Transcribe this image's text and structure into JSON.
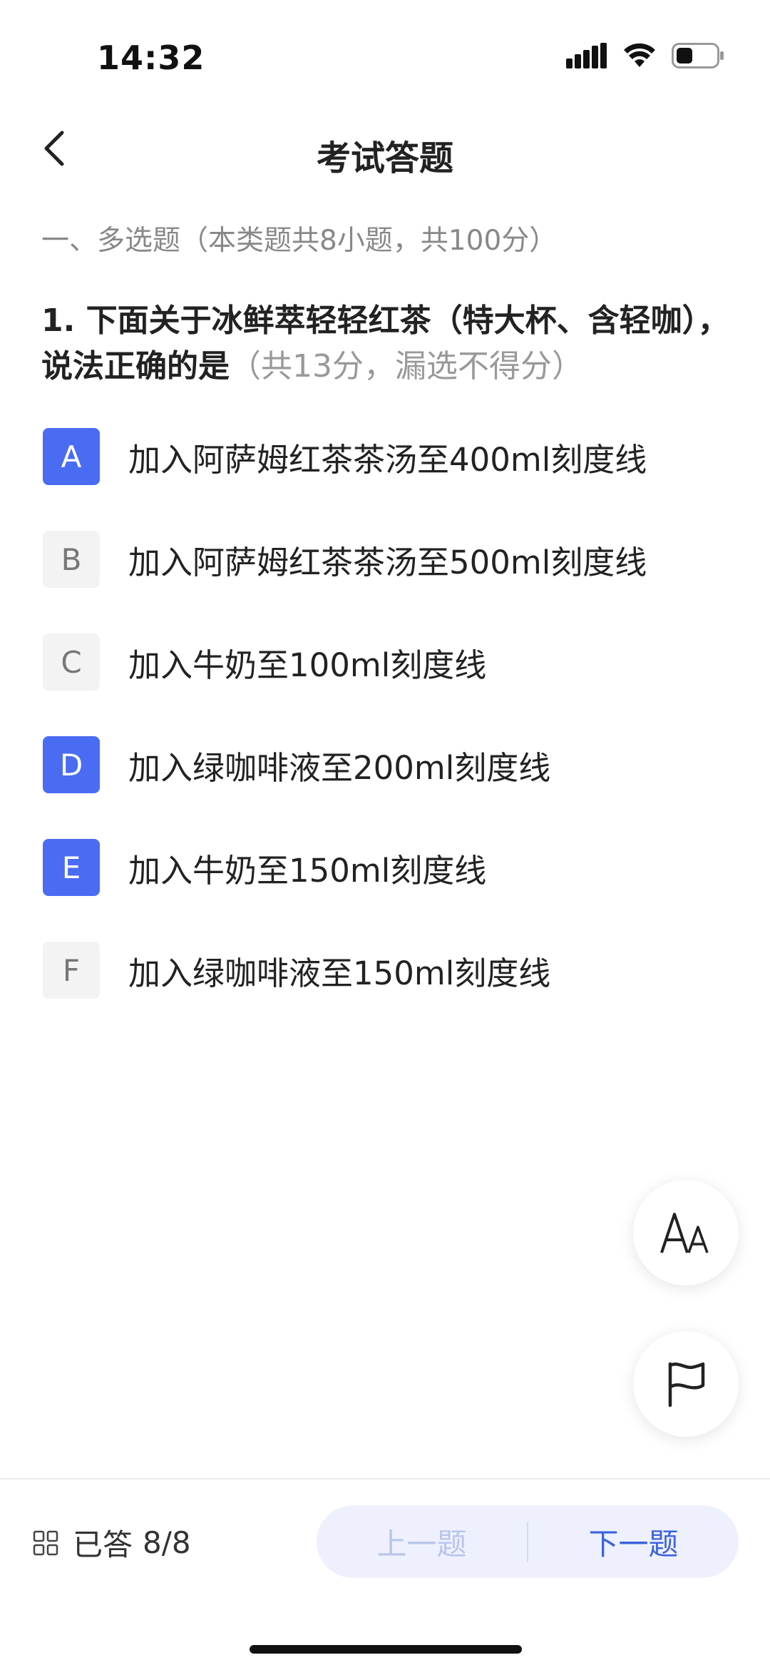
{
  "status_bar": {
    "time": "14:32"
  },
  "nav": {
    "title": "考试答题"
  },
  "section": {
    "title": "一、多选题（本类题共8小题，共100分）"
  },
  "question": {
    "text": "1.  下面关于冰鲜萃轻轻红茶（特大杯、含轻咖），说法正确的是",
    "points_note": "（共13分，漏选不得分）"
  },
  "options": [
    {
      "letter": "A",
      "text": "加入阿萨姆红茶茶汤至400ml刻度线",
      "selected": true
    },
    {
      "letter": "B",
      "text": "加入阿萨姆红茶茶汤至500ml刻度线",
      "selected": false
    },
    {
      "letter": "C",
      "text": "加入牛奶至100ml刻度线",
      "selected": false
    },
    {
      "letter": "D",
      "text": "加入绿咖啡液至200ml刻度线",
      "selected": true
    },
    {
      "letter": "E",
      "text": "加入牛奶至150ml刻度线",
      "selected": true
    },
    {
      "letter": "F",
      "text": "加入绿咖啡液至150ml刻度线",
      "selected": false
    }
  ],
  "fab": {
    "font_size_icon": "font-size-icon",
    "flag_icon": "flag-icon"
  },
  "footer": {
    "answered_label": "已答",
    "answered_count": "8/8",
    "prev_label": "上一题",
    "next_label": "下一题"
  },
  "colors": {
    "accent": "#4a6cf2",
    "next_text": "#3d63e0",
    "pill_bg": "#eef1fd"
  }
}
